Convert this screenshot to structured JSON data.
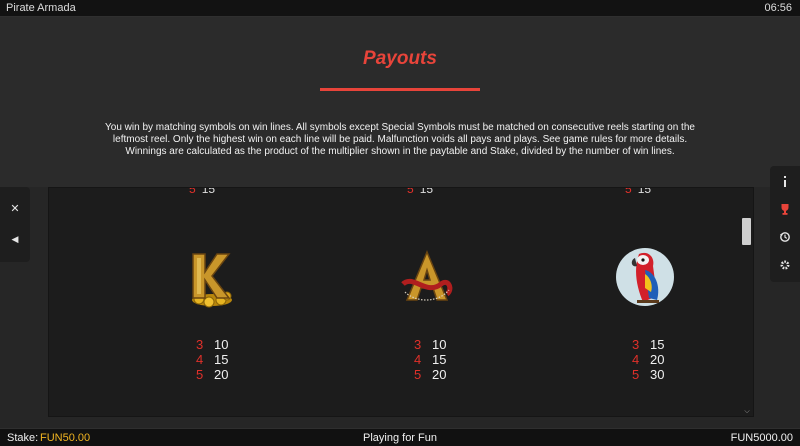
{
  "app": {
    "title": "Pirate Armada",
    "clock": "06:56"
  },
  "page": {
    "title": "Payouts",
    "rules": "You win by matching symbols on win lines. All symbols except Special Symbols must be matched on consecutive reels starting on the leftmost reel. Only the highest win on each line will be paid. Malfunction voids all pays and plays. See game rules for more details. Winnings are calculated as the product of the multiplier shown in the paytable and Stake, divided by the number of win lines."
  },
  "left_sidebar": {
    "close_icon": "close-icon",
    "back_icon": "triangle-left-icon"
  },
  "right_sidebar": {
    "icons": [
      "info-icon",
      "trophy-icon",
      "history-icon",
      "gear-icon"
    ]
  },
  "paytable": {
    "partial_row": {
      "count": "5",
      "value": "15"
    },
    "symbols": [
      {
        "name": "K",
        "icon": "gold-letter-k-icon",
        "pays": [
          {
            "count": "3",
            "value": "10"
          },
          {
            "count": "4",
            "value": "15"
          },
          {
            "count": "5",
            "value": "20"
          }
        ]
      },
      {
        "name": "A",
        "icon": "gold-letter-a-icon",
        "pays": [
          {
            "count": "3",
            "value": "10"
          },
          {
            "count": "4",
            "value": "15"
          },
          {
            "count": "5",
            "value": "20"
          }
        ]
      },
      {
        "name": "Parrot",
        "icon": "parrot-icon",
        "pays": [
          {
            "count": "3",
            "value": "15"
          },
          {
            "count": "4",
            "value": "20"
          },
          {
            "count": "5",
            "value": "30"
          }
        ]
      }
    ]
  },
  "footer": {
    "stake_label": "Stake:",
    "stake_value": "FUN50.00",
    "mode": "Playing for Fun",
    "balance": "FUN5000.00"
  },
  "colors": {
    "accent": "#e8443a",
    "stake": "#f2b521",
    "count_red": "#e0302a"
  }
}
